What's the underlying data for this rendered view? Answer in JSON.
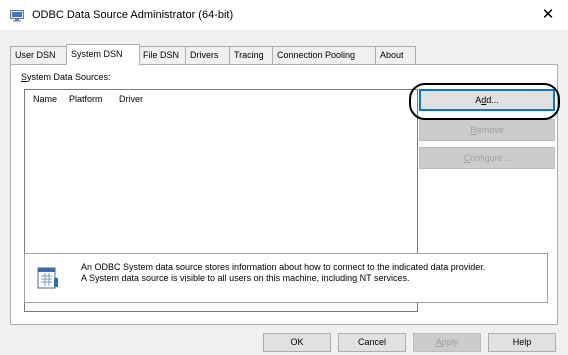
{
  "window": {
    "title": "ODBC Data Source Administrator (64-bit)",
    "close_glyph": "✕",
    "icon": "odbc-admin-icon"
  },
  "tabs": [
    {
      "label": "User DSN"
    },
    {
      "label": "System DSN",
      "active": true
    },
    {
      "label": "File DSN"
    },
    {
      "label": "Drivers"
    },
    {
      "label": "Tracing"
    },
    {
      "label": "Connection Pooling"
    },
    {
      "label": "About"
    }
  ],
  "system_dsn": {
    "group_label_prefix": "S",
    "group_label_rest": "ystem Data Sources:",
    "columns": [
      "Name",
      "Platform",
      "Driver"
    ],
    "rows": [],
    "buttons": {
      "add": {
        "pre": "A",
        "ul": "d",
        "post": "d..."
      },
      "remove": {
        "pre": "",
        "ul": "R",
        "post": "emove"
      },
      "configure": {
        "pre": "",
        "ul": "C",
        "post": "onfigure..."
      }
    },
    "info_line1": "An ODBC System data source stores information about how to connect to the indicated data provider.",
    "info_line2": "A System data source is visible to all users on this machine, including NT services.",
    "info_icon": "data-source-book-icon"
  },
  "footer": {
    "ok": "OK",
    "cancel": "Cancel",
    "apply_ul": "A",
    "apply_rest": "pply",
    "help": "Help"
  }
}
